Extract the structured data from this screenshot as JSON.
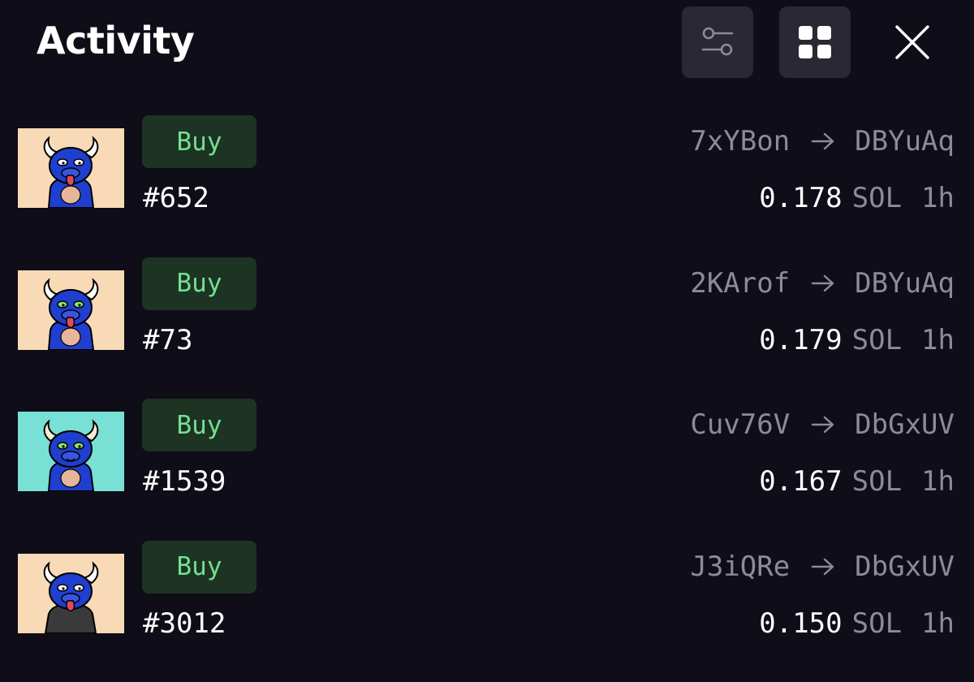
{
  "header": {
    "title": "Activity",
    "filter_icon": "sliders-icon",
    "grid_icon": "grid-view-icon",
    "close_icon": "close-icon"
  },
  "colors": {
    "background": "#0f0d18",
    "button_bg": "#2a2833",
    "buy_badge_bg": "#1d3324",
    "buy_text": "#74e08f",
    "muted_text": "#8d8a99",
    "thumb_peach": "#f9dab6",
    "thumb_teal": "#79e0d5",
    "bull_blue": "#1f3fcf"
  },
  "activity": [
    {
      "type": "Buy",
      "token": "#652",
      "from": "7xYBon",
      "to": "DBYuAq",
      "price": "0.178",
      "unit": "SOL",
      "time": "1h",
      "thumb_bg": "#f9dab6"
    },
    {
      "type": "Buy",
      "token": "#73",
      "from": "2KArof",
      "to": "DBYuAq",
      "price": "0.179",
      "unit": "SOL",
      "time": "1h",
      "thumb_bg": "#f9dab6"
    },
    {
      "type": "Buy",
      "token": "#1539",
      "from": "Cuv76V",
      "to": "DbGxUV",
      "price": "0.167",
      "unit": "SOL",
      "time": "1h",
      "thumb_bg": "#79e0d5"
    },
    {
      "type": "Buy",
      "token": "#3012",
      "from": "J3iQRe",
      "to": "DbGxUV",
      "price": "0.150",
      "unit": "SOL",
      "time": "1h",
      "thumb_bg": "#f9dab6"
    }
  ]
}
